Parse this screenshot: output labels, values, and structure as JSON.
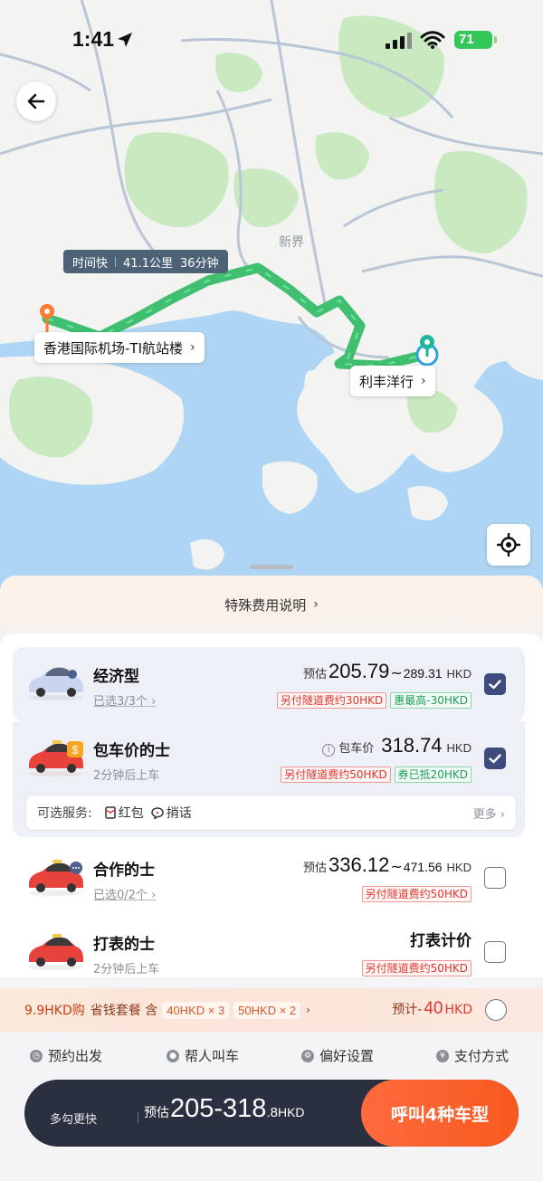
{
  "status_bar": {
    "time": "1:41",
    "battery": "71"
  },
  "map": {
    "route_tag": {
      "label": "时间快",
      "distance": "41.1公里",
      "duration": "36分钟"
    },
    "origin": {
      "name": "香港国际机场-TI航站楼",
      "chevron": "›"
    },
    "destination": {
      "name": "利丰洋行",
      "chevron": "›"
    },
    "district_label": "新界",
    "colors": {
      "water": "#aed6f4",
      "land": "#f3f3f1",
      "park": "#c9e9c1",
      "route": "#3fbf6f"
    }
  },
  "sheet": {
    "notice": "特殊费用说明",
    "rides": [
      {
        "name": "经济型",
        "sub": "已选3/3个",
        "price_label": "预估",
        "price_low": "205.79",
        "price_high": "289.31",
        "unit": "HKD",
        "tags": [
          "另付隧道费约30HKD",
          "惠最高-30HKD"
        ],
        "checked": true
      },
      {
        "name": "包车价的士",
        "sub": "2分钟后上车",
        "price_label": "包车价",
        "price_low": "318.74",
        "unit": "HKD",
        "tags": [
          "另付隧道费约50HKD",
          "券已抵20HKD"
        ],
        "checked": true
      },
      {
        "name": "合作的士",
        "sub": "已选0/2个",
        "price_label": "预估",
        "price_low": "336.12",
        "price_high": "471.56",
        "unit": "HKD",
        "tags": [
          "另付隧道费约50HKD"
        ],
        "checked": false
      },
      {
        "name": "打表的士",
        "sub": "2分钟后上车",
        "price_text": "打表计价",
        "tags": [
          "另付隧道费约50HKD"
        ],
        "checked": false
      }
    ],
    "services": {
      "label": "可选服务:",
      "items": [
        "红包",
        "捎话"
      ],
      "more": "更多"
    },
    "promo": {
      "price": "9.9HKD购",
      "desc": "省钱套餐 含",
      "coupons": [
        "40HKD × 3",
        "50HKD × 2"
      ],
      "estimate_label": "预计-",
      "estimate_amount": "40",
      "estimate_currency": "HKD"
    },
    "options": [
      "预约出发",
      "帮人叫车",
      "偏好设置",
      "支付方式"
    ],
    "bottom_bar": {
      "tip": "多勾更快",
      "estimate_label": "预估",
      "estimate_range": "205-318",
      "estimate_decimal": ".8",
      "currency": "HKD",
      "call_button": "呼叫4种车型"
    }
  }
}
